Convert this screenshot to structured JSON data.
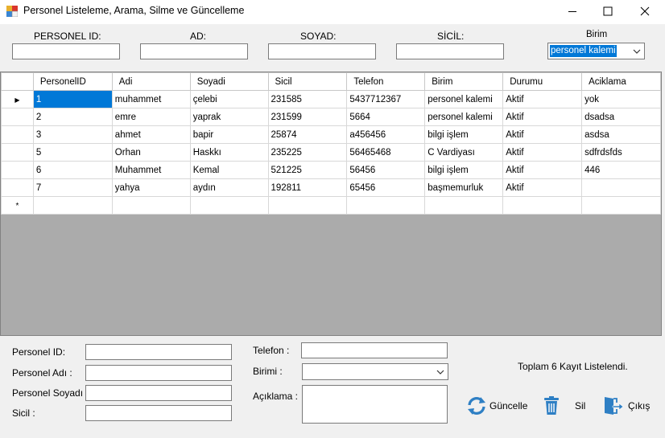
{
  "window": {
    "title": "Personel Listeleme, Arama, Silme ve Güncelleme"
  },
  "search": {
    "personel_id_label": "PERSONEL ID:",
    "ad_label": "AD:",
    "soyad_label": "SOYAD:",
    "sicil_label": "SİCİL:",
    "birim_label": "Birim",
    "personel_id_value": "",
    "ad_value": "",
    "soyad_value": "",
    "sicil_value": "",
    "birim_selected": "personel kalemi"
  },
  "grid": {
    "columns": [
      "PersonelID",
      "Adi",
      "Soyadi",
      "Sicil",
      "Telefon",
      "Birim",
      "Durumu",
      "Aciklama"
    ],
    "rows": [
      [
        "1",
        "muhammet",
        "çelebi",
        "231585",
        "5437712367",
        "personel kalemi",
        "Aktif",
        "yok"
      ],
      [
        "2",
        "emre",
        "yaprak",
        "231599",
        "5664",
        "personel kalemi",
        "Aktif",
        "dsadsa"
      ],
      [
        "3",
        "ahmet",
        "bapir",
        "25874",
        "a456456",
        "bilgi işlem",
        "Aktif",
        "asdsa"
      ],
      [
        "5",
        "Orhan",
        "Haskkı",
        "235225",
        "56465468",
        "C Vardiyası",
        "Aktif",
        "sdfrdsfds"
      ],
      [
        "6",
        "Muhammet",
        "Kemal",
        "521225",
        "56456",
        "bilgi işlem",
        "Aktif",
        "446"
      ],
      [
        "7",
        "yahya",
        "aydın",
        "192811",
        "65456",
        "başmemurluk",
        "Aktif",
        ""
      ]
    ],
    "current_row_marker": "▶",
    "new_row_marker": "*"
  },
  "detail": {
    "personel_id_label": "Personel ID:",
    "personel_adi_label": "Personel Adı :",
    "personel_soyadi_label": "Personel Soyadı :",
    "sicil_label": "Sicil :",
    "telefon_label": "Telefon :",
    "birimi_label": "Birimi :",
    "aciklama_label": "Açıklama :"
  },
  "status": {
    "count_text": "Toplam 6 Kayıt Listelendi."
  },
  "actions": {
    "guncelle_label": "Güncelle",
    "sil_label": "Sil",
    "cikis_label": "Çıkış"
  },
  "colors": {
    "selection": "#0078d7",
    "grid_background": "#ababab",
    "form_background": "#f0f0f0",
    "icon_blue": "#2e7fc4"
  }
}
